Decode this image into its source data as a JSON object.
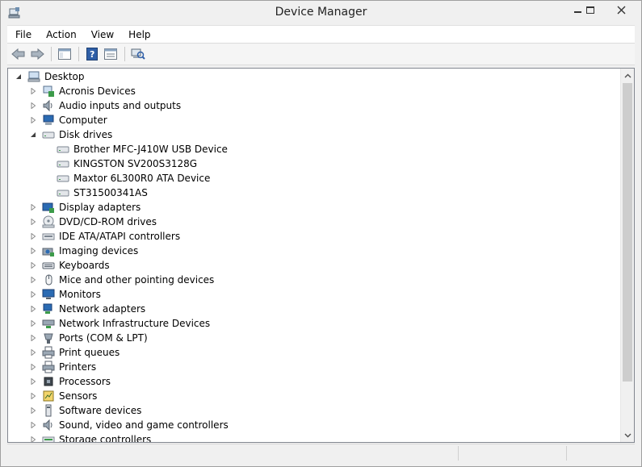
{
  "window": {
    "title": "Device Manager"
  },
  "menu": [
    "File",
    "Action",
    "View",
    "Help"
  ],
  "toolbar": [
    {
      "icon": "back-arrow-icon"
    },
    {
      "icon": "forward-arrow-icon"
    },
    {
      "icon": "show-hide-console-tree-icon"
    },
    {
      "icon": "help-icon"
    },
    {
      "icon": "properties-icon"
    },
    {
      "icon": "scan-hardware-changes-icon"
    }
  ],
  "tree": {
    "root": "Desktop",
    "items": [
      {
        "label": "Acronis Devices",
        "icon": "acronis-device-icon",
        "expanded": false,
        "level": 1
      },
      {
        "label": "Audio inputs and outputs",
        "icon": "speaker-icon",
        "expanded": false,
        "level": 1
      },
      {
        "label": "Computer",
        "icon": "computer-icon",
        "expanded": false,
        "level": 1
      },
      {
        "label": "Disk drives",
        "icon": "disk-drive-icon",
        "expanded": true,
        "level": 1
      },
      {
        "label": "Brother MFC-J410W USB Device",
        "icon": "disk-drive-icon",
        "level": 2
      },
      {
        "label": "KINGSTON SV200S3128G",
        "icon": "disk-drive-icon",
        "level": 2
      },
      {
        "label": "Maxtor 6L300R0 ATA Device",
        "icon": "disk-drive-icon",
        "level": 2
      },
      {
        "label": "ST31500341AS",
        "icon": "disk-drive-icon",
        "level": 2
      },
      {
        "label": "Display adapters",
        "icon": "display-adapter-icon",
        "expanded": false,
        "level": 1
      },
      {
        "label": "DVD/CD-ROM drives",
        "icon": "dvd-drive-icon",
        "expanded": false,
        "level": 1
      },
      {
        "label": "IDE ATA/ATAPI controllers",
        "icon": "ide-controller-icon",
        "expanded": false,
        "level": 1
      },
      {
        "label": "Imaging devices",
        "icon": "camera-icon",
        "expanded": false,
        "level": 1
      },
      {
        "label": "Keyboards",
        "icon": "keyboard-icon",
        "expanded": false,
        "level": 1
      },
      {
        "label": "Mice and other pointing devices",
        "icon": "mouse-icon",
        "expanded": false,
        "level": 1
      },
      {
        "label": "Monitors",
        "icon": "monitor-icon",
        "expanded": false,
        "level": 1
      },
      {
        "label": "Network adapters",
        "icon": "network-adapter-icon",
        "expanded": false,
        "level": 1
      },
      {
        "label": "Network Infrastructure Devices",
        "icon": "network-infrastructure-icon",
        "expanded": false,
        "level": 1
      },
      {
        "label": "Ports (COM & LPT)",
        "icon": "port-icon",
        "expanded": false,
        "level": 1
      },
      {
        "label": "Print queues",
        "icon": "printer-icon",
        "expanded": false,
        "level": 1
      },
      {
        "label": "Printers",
        "icon": "printer-icon",
        "expanded": false,
        "level": 1
      },
      {
        "label": "Processors",
        "icon": "processor-icon",
        "expanded": false,
        "level": 1
      },
      {
        "label": "Sensors",
        "icon": "sensor-icon",
        "expanded": false,
        "level": 1
      },
      {
        "label": "Software devices",
        "icon": "software-device-icon",
        "expanded": false,
        "level": 1
      },
      {
        "label": "Sound, video and game controllers",
        "icon": "sound-controller-icon",
        "expanded": false,
        "level": 1
      },
      {
        "label": "Storage controllers",
        "icon": "storage-controller-icon",
        "expanded": false,
        "level": 1
      }
    ]
  },
  "colors": {
    "window_bg": "#f0f0f0",
    "pane_bg": "#ffffff",
    "accent": "#3a6ea5"
  }
}
